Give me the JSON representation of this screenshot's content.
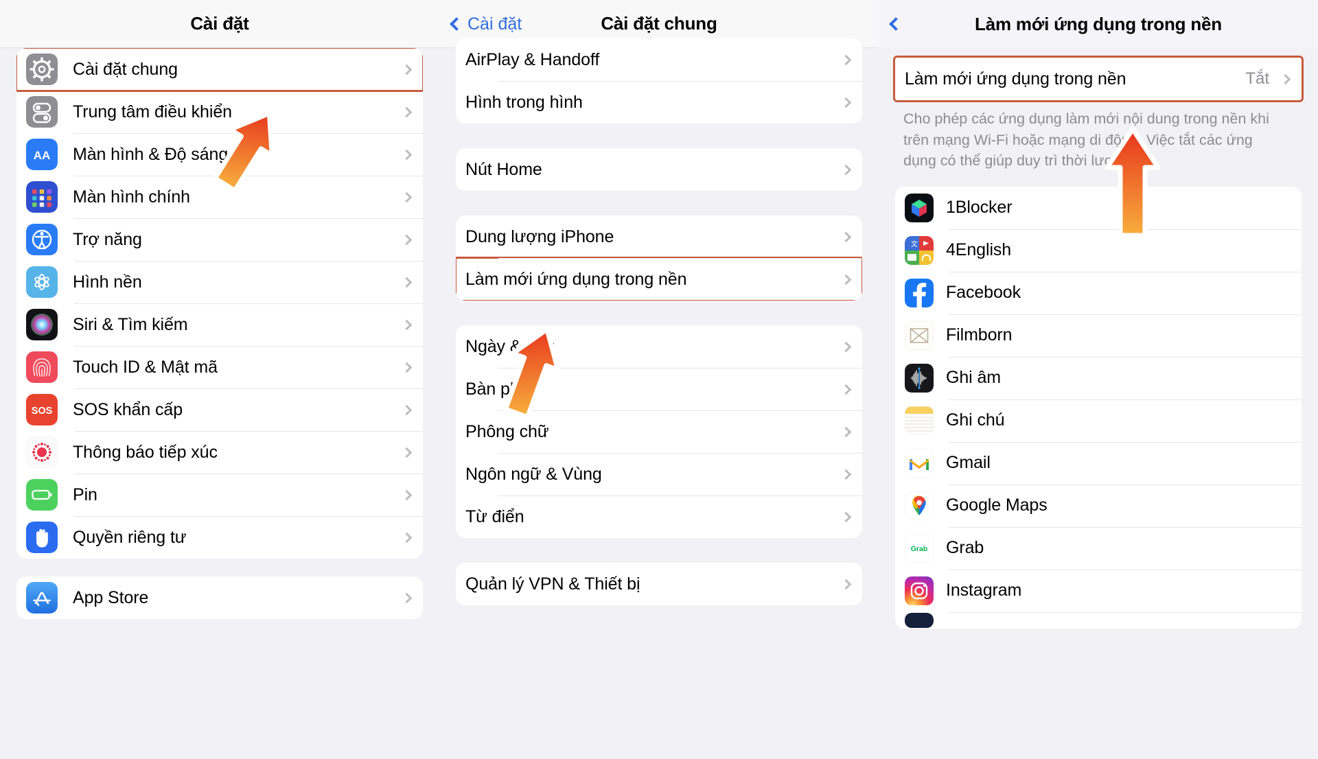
{
  "panel1": {
    "nav": {
      "title": "Cài đặt"
    },
    "groups": [
      {
        "highlight_first_row": true,
        "rows": [
          {
            "label": "Cài đặt chung",
            "icon": "gear-icon",
            "highlight": true
          },
          {
            "label": "Trung tâm điều khiển",
            "icon": "control-center-icon"
          },
          {
            "label": "Màn hình & Độ sáng",
            "icon": "display-brightness-icon"
          },
          {
            "label": "Màn hình chính",
            "icon": "home-screen-icon"
          },
          {
            "label": "Trợ năng",
            "icon": "accessibility-icon"
          },
          {
            "label": "Hình nền",
            "icon": "wallpaper-icon"
          },
          {
            "label": "Siri & Tìm kiếm",
            "icon": "siri-icon"
          },
          {
            "label": "Touch ID & Mật mã",
            "icon": "touch-id-icon"
          },
          {
            "label": "SOS khẩn cấp",
            "icon": "sos-icon"
          },
          {
            "label": "Thông báo tiếp xúc",
            "icon": "exposure-notification-icon"
          },
          {
            "label": "Pin",
            "icon": "battery-icon"
          },
          {
            "label": "Quyền riêng tư",
            "icon": "privacy-hand-icon"
          }
        ]
      },
      {
        "rows": [
          {
            "label": "App Store",
            "icon": "app-store-icon"
          }
        ]
      }
    ]
  },
  "panel2": {
    "nav": {
      "back_label": "Cài đặt",
      "title": "Cài đặt chung"
    },
    "groups": [
      {
        "rows": [
          {
            "label": "AirPlay & Handoff"
          },
          {
            "label": "Hình trong hình"
          }
        ]
      },
      {
        "rows": [
          {
            "label": "Nút Home"
          }
        ]
      },
      {
        "rows": [
          {
            "label": "Dung lượng iPhone"
          },
          {
            "label": "Làm mới ứng dụng trong nền",
            "highlight": true
          }
        ]
      },
      {
        "rows": [
          {
            "label": "Ngày & Giờ"
          },
          {
            "label": "Bàn phím"
          },
          {
            "label": "Phông chữ"
          },
          {
            "label": "Ngôn ngữ & Vùng"
          },
          {
            "label": "Từ điển"
          }
        ]
      },
      {
        "rows": [
          {
            "label": "Quản lý VPN & Thiết bị"
          }
        ]
      }
    ]
  },
  "panel3": {
    "nav": {
      "title": "Làm mới ứng dụng trong nền"
    },
    "toggle_row": {
      "label": "Làm mới ứng dụng trong nền",
      "value": "Tắt",
      "highlight": true
    },
    "footnote": "Cho phép các ứng dụng làm mới nội dung trong nền khi trên mạng Wi-Fi hoặc mạng di động. Việc tắt các ứng dụng có thể giúp duy trì thời lượng pin.",
    "apps": [
      {
        "label": "1Blocker",
        "icon": "1blocker-icon"
      },
      {
        "label": "4English",
        "icon": "4english-icon"
      },
      {
        "label": "Facebook",
        "icon": "facebook-icon"
      },
      {
        "label": "Filmborn",
        "icon": "filmborn-icon"
      },
      {
        "label": "Ghi âm",
        "icon": "voice-memos-icon"
      },
      {
        "label": "Ghi chú",
        "icon": "notes-icon"
      },
      {
        "label": "Gmail",
        "icon": "gmail-icon"
      },
      {
        "label": "Google Maps",
        "icon": "google-maps-icon"
      },
      {
        "label": "Grab",
        "icon": "grab-icon"
      },
      {
        "label": "Instagram",
        "icon": "instagram-icon"
      }
    ]
  },
  "annotations": {
    "accent_color": "#c75b3c",
    "cursor_gradient_top": "#e8341c",
    "cursor_gradient_bottom": "#f6a83a",
    "cursors": [
      {
        "name": "cursor-arrow-control-center",
        "direction": "up-left-tilt"
      },
      {
        "name": "cursor-arrow-background-refresh",
        "direction": "up-left-tilt"
      },
      {
        "name": "cursor-arrow-refresh-toggle",
        "direction": "up"
      }
    ]
  }
}
